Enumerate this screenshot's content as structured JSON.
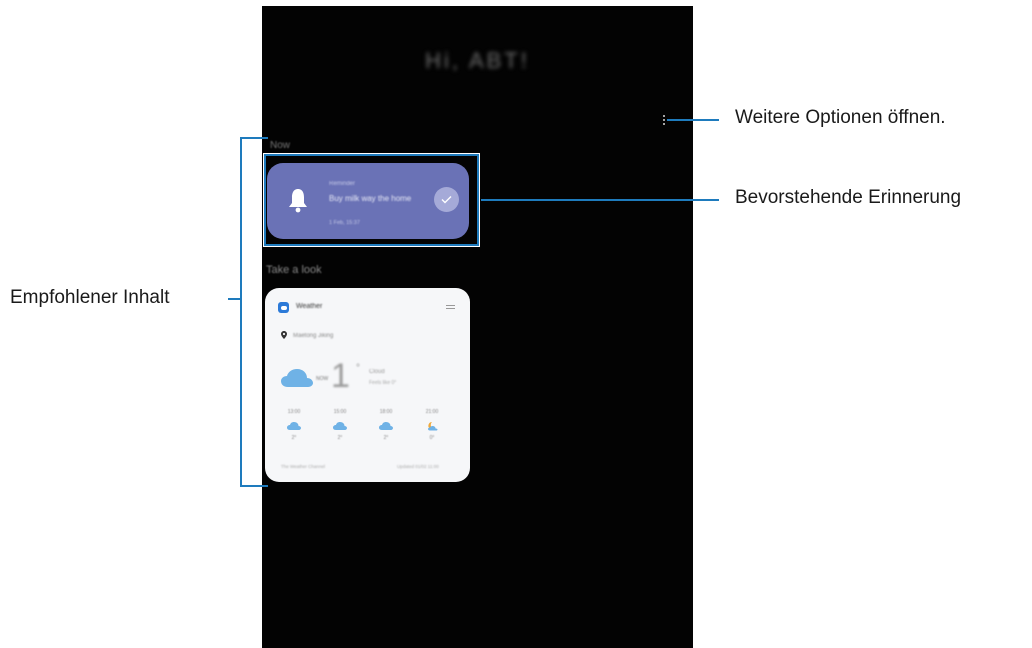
{
  "lockscreen": {
    "greeting": "Hi, ABT!",
    "section_now": "Now",
    "section_look": "Take a look"
  },
  "reminder": {
    "small_label": "Reminder",
    "title": "Buy milk way the home",
    "time": "1 Feb, 15:37",
    "icon": "bell-icon",
    "accent": "#6a72b6"
  },
  "weather": {
    "app_label": "Weather",
    "location": "Maetong Jiking",
    "now_label": "NOW",
    "temperature": "1",
    "degree": "°",
    "condition": "Cloud",
    "condition_sub": "Feels like 0°",
    "forecast": [
      {
        "time": "13:00",
        "icon": "cloud-icon",
        "temp": "2°"
      },
      {
        "time": "15:00",
        "icon": "cloud-icon",
        "temp": "2°"
      },
      {
        "time": "18:00",
        "icon": "cloud-icon",
        "temp": "2°"
      },
      {
        "time": "21:00",
        "icon": "moon-cloud-icon",
        "temp": "0°"
      }
    ],
    "footer_left": "The Weather Channel",
    "footer_right": "Updated 01/02 11:00"
  },
  "callouts": {
    "more_options": "Weitere Optionen öffnen.",
    "upcoming_reminder": "Bevorstehende Erinnerung",
    "recommended_content": "Empfohlener Inhalt",
    "line_color": "#1e7bbd"
  }
}
